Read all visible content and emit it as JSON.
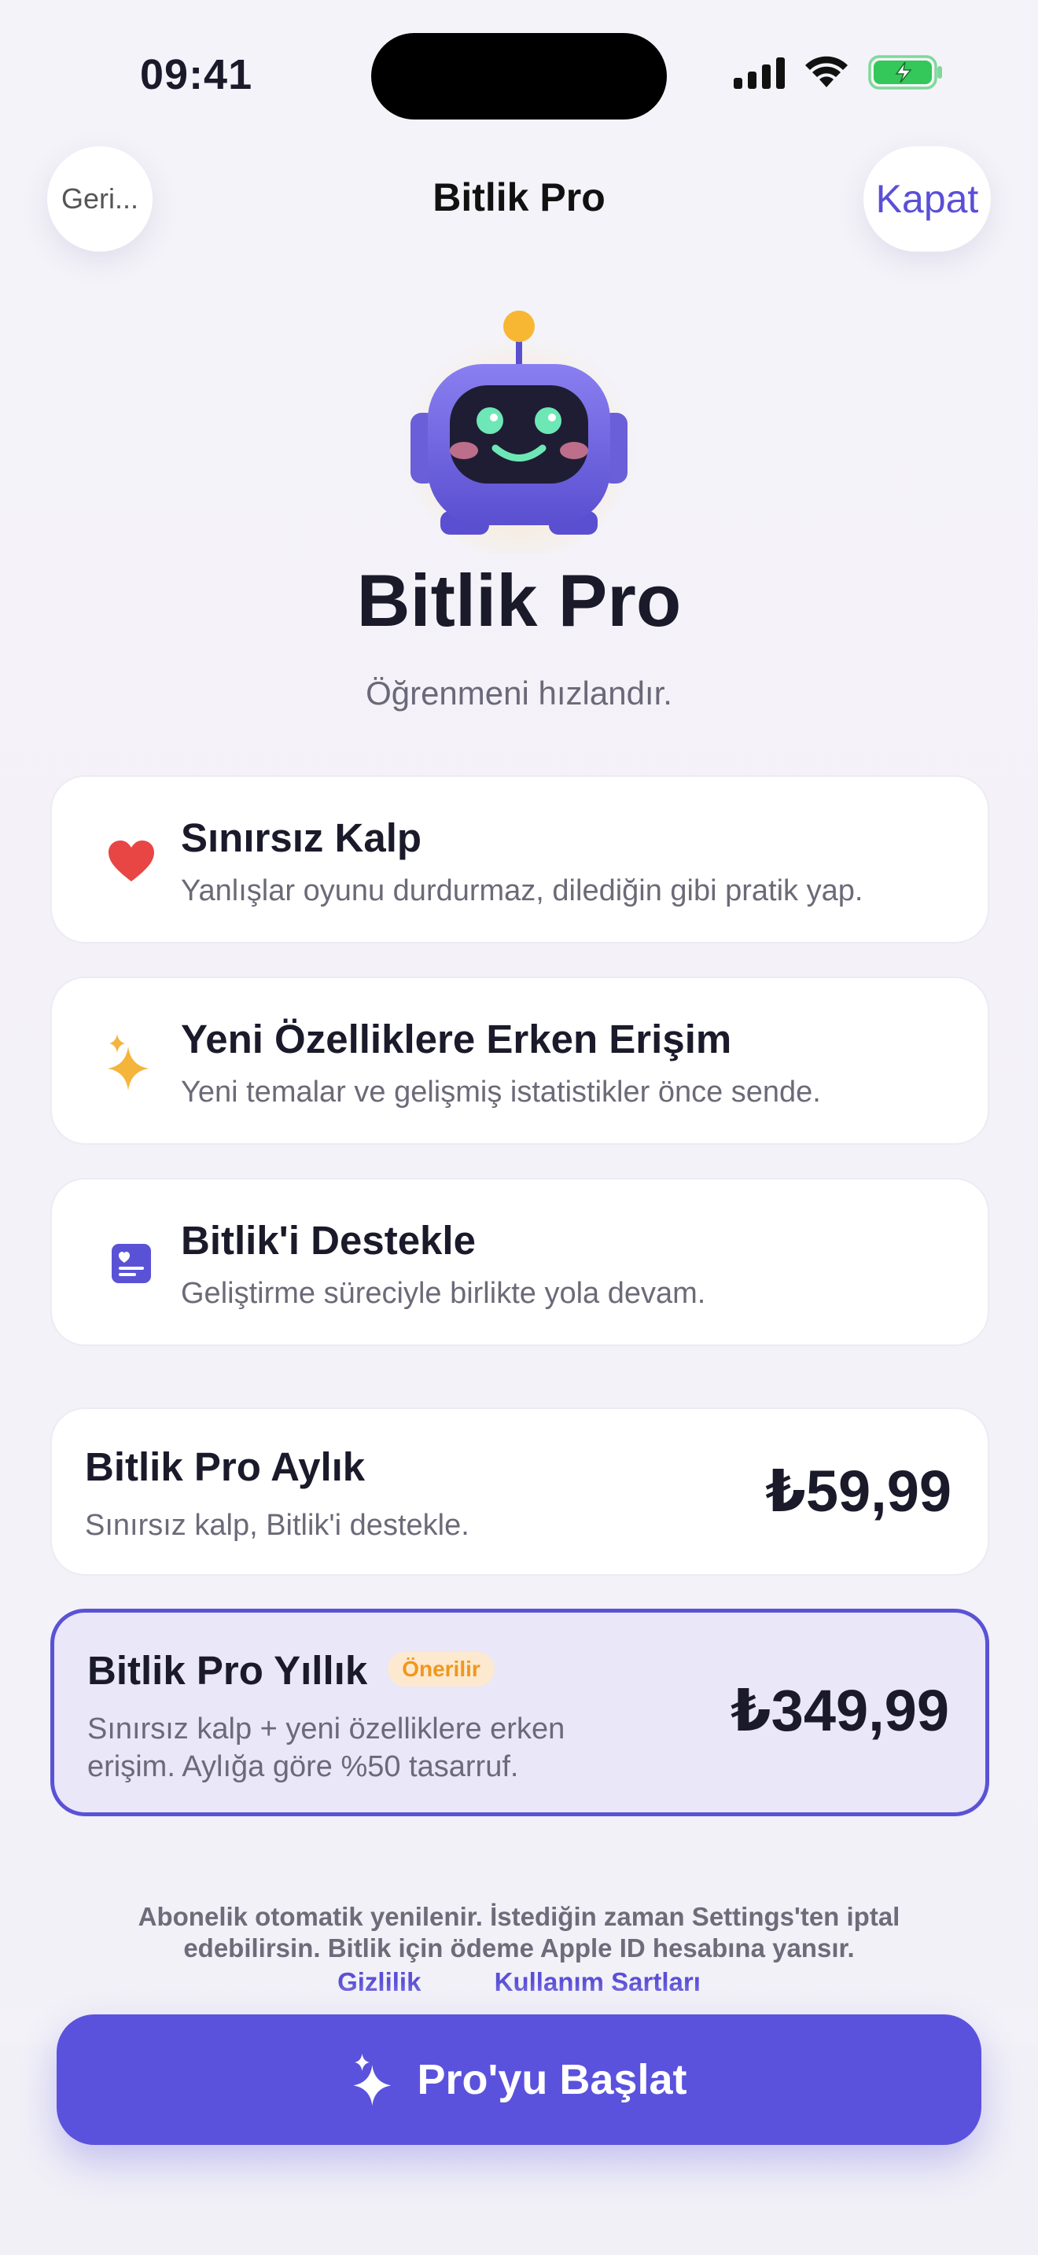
{
  "status_bar": {
    "time": "09:41"
  },
  "nav": {
    "back_label": "Geri...",
    "title": "Bitlik Pro",
    "close_label": "Kapat"
  },
  "hero": {
    "title": "Bitlik Pro",
    "subtitle": "Öğrenmeni hızlandır."
  },
  "features": [
    {
      "title": "Sınırsız Kalp",
      "description": "Yanlışlar oyunu durdurmaz, dilediğin gibi pratik yap.",
      "icon": "heart-icon"
    },
    {
      "title": "Yeni Özelliklere Erken Erişim",
      "description": "Yeni temalar ve gelişmiş istatistikler önce sende.",
      "icon": "sparkles-icon"
    },
    {
      "title": "Bitlik'i Destekle",
      "description": "Geliştirme süreciyle birlikte yola devam.",
      "icon": "note-heart-icon"
    }
  ],
  "plans": [
    {
      "title": "Bitlik Pro Aylık",
      "description": "Sınırsız kalp, Bitlik'i destekle.",
      "price": "₺59,99"
    },
    {
      "title": "Bitlik Pro Yıllık",
      "badge": "Önerilir",
      "description": "Sınırsız kalp + yeni özelliklere erken erişim. Aylığa göre %50 tasarruf.",
      "price": "₺349,99",
      "selected": true
    }
  ],
  "legal_text": "Abonelik otomatik yenilenir. İstediğin zaman Settings'ten iptal edebilirsin. Bitlik için ödeme Apple ID hesabına yansır.",
  "links": {
    "privacy": "Gizlilik",
    "terms": "Kullanım Şartları"
  },
  "cta": {
    "label": "Pro'yu Başlat",
    "icon": "sparkles-icon"
  },
  "colors": {
    "accent": "#5a52dc",
    "badge_text": "#f0971d",
    "heart": "#e84545",
    "sparkle": "#f5b43a"
  }
}
